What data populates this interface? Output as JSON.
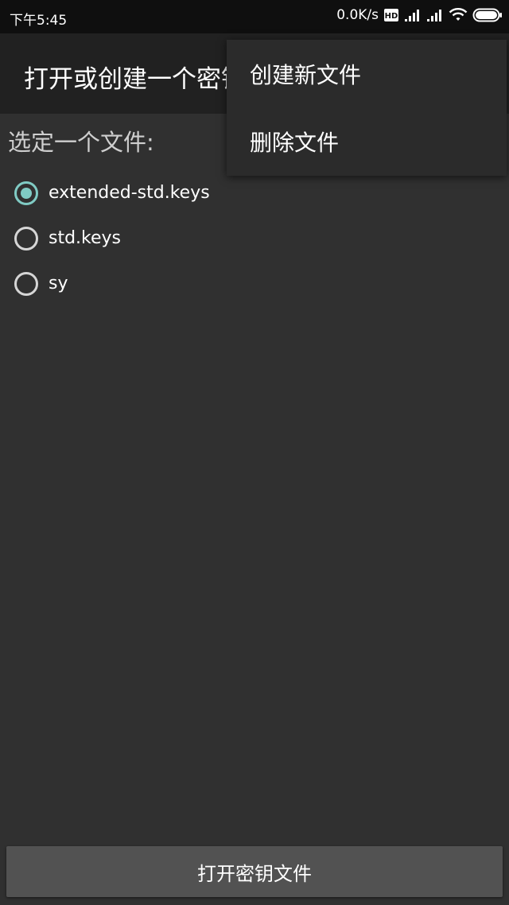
{
  "status_bar": {
    "time": "下午5:45",
    "net_speed": "0.0K/s",
    "icons": [
      "hd-icon",
      "signal-icon",
      "signal-icon",
      "wifi-icon",
      "battery-icon"
    ]
  },
  "action_bar": {
    "title": "打开或创建一个密钥文件"
  },
  "overflow_menu": {
    "items": [
      {
        "label": "创建新文件"
      },
      {
        "label": "删除文件"
      }
    ]
  },
  "main": {
    "prompt": "选定一个文件:",
    "files": [
      {
        "name": "extended-std.keys",
        "selected": true
      },
      {
        "name": "std.keys",
        "selected": false
      },
      {
        "name": "sy",
        "selected": false
      }
    ],
    "open_button_label": "打开密钥文件"
  },
  "colors": {
    "accent": "#80cbc4",
    "background": "#303030",
    "action_bar": "#212121",
    "status_bar": "#0f0f0f"
  }
}
